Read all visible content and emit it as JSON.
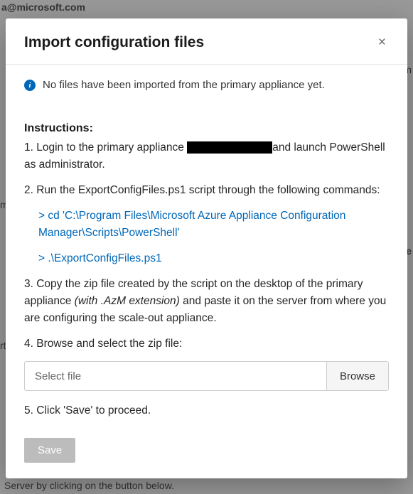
{
  "background": {
    "top": "a@microsoft.com",
    "right1": "om",
    "right2": "ne",
    "left1": "m",
    "left2": "rt",
    "bottom": "Server by clicking on the button below."
  },
  "modal": {
    "title": "Import configuration files",
    "close": "×",
    "info_message": "No files have been imported from the primary appliance yet.",
    "instructions_label": "Instructions:",
    "step1_prefix": "1. Login to the primary appliance ",
    "step1_suffix": "and launch PowerShell as administrator.",
    "step2": "2. Run the ExportConfigFiles.ps1 script through the following commands:",
    "cmd1": "> cd 'C:\\Program Files\\Microsoft Azure Appliance Configuration Manager\\Scripts\\PowerShell'",
    "cmd2": "> .\\ExportConfigFiles.ps1",
    "step3_prefix": "3. Copy the zip file created by the script on the desktop of the primary appliance ",
    "step3_italic": "(with .AzM extension)",
    "step3_suffix": " and paste it on the server from where you are configuring the scale-out appliance.",
    "step4": "4. Browse and select the zip file:",
    "file_placeholder": "Select file",
    "browse_label": "Browse",
    "step5": "5. Click 'Save' to proceed.",
    "save_label": "Save"
  }
}
